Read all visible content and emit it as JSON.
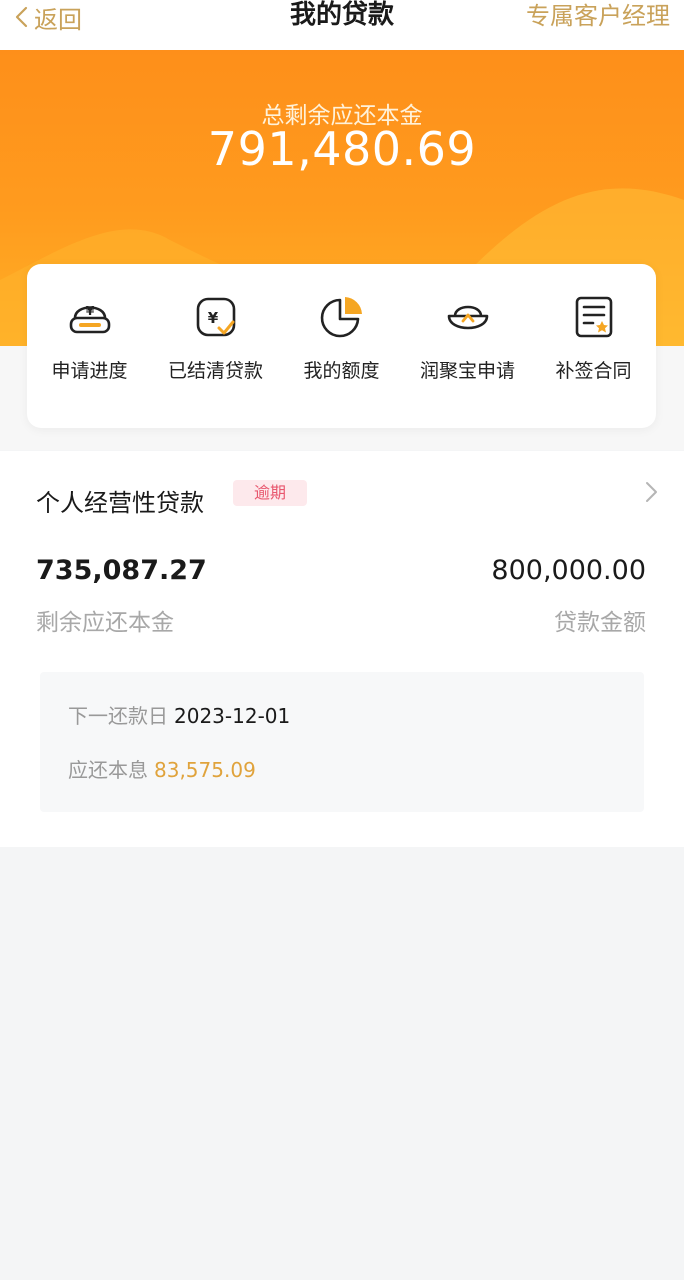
{
  "nav": {
    "back_label": "返回",
    "title": "我的贷款",
    "manager_label": "专属客户经理"
  },
  "summary": {
    "label": "总剩余应还本金",
    "amount": "791,480.69"
  },
  "quick_actions": [
    {
      "label": "申请进度",
      "icon": "loan-progress-icon"
    },
    {
      "label": "已结清贷款",
      "icon": "settled-loan-icon"
    },
    {
      "label": "我的额度",
      "icon": "pie-chart-icon"
    },
    {
      "label": "润聚宝申请",
      "icon": "gold-ingot-icon"
    },
    {
      "label": "补签合同",
      "icon": "contract-icon"
    }
  ],
  "loan": {
    "name": "个人经营性贷款",
    "status_badge": "逾期",
    "remaining_principal": "735,087.27",
    "remaining_principal_label": "剩余应还本金",
    "loan_amount": "800,000.00",
    "loan_amount_label": "贷款金额",
    "next_due_label": "下一还款日",
    "next_due_date": "2023-12-01",
    "due_amount_label": "应还本息",
    "due_amount": "83,575.09"
  },
  "colors": {
    "accent_gold": "#c9a25a",
    "hero_orange": "#ff9b1e",
    "overdue_red": "#e8576e",
    "due_amount_orange": "#e0a33c"
  }
}
